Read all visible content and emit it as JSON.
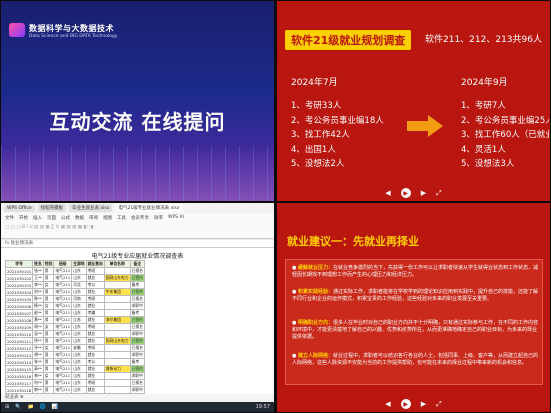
{
  "top_left": {
    "logo_title": "数据科学与大数据技术",
    "logo_subtitle": "Data Science and BIG DATA Technology",
    "main_text": "互动交流  在线提问"
  },
  "top_right": {
    "title": "软件21级就业规划调查",
    "subtitle": "软件211、212、213共96人",
    "left_heading": "2024年7月",
    "right_heading": "2024年9月",
    "left_items": [
      "1、考研33人",
      "2、考公务员事业编18人",
      "3、找工作42人",
      "4、出国1人",
      "5、没想法2人"
    ],
    "right_items": [
      "1、考研7人",
      "2、考公务员事业编25人",
      "3、找工作60人（已就业7人）",
      "4、灵活1人",
      "5、没想法3人"
    ],
    "accent": "#ffd000",
    "background": "#b8160f"
  },
  "bottom_right": {
    "title": "就业建议一：先就业再择业",
    "items": [
      {
        "lead": "缓解就业压力：",
        "text": "在就业竞争激烈的当下，先获得一份工作可以让求职者快速从学生就得业状态到工作状态，减轻因长期找不到理想工作而产生的心理压力和经济压力。"
      },
      {
        "lead": "积累实践经验：",
        "text": "通过实际工作，求职者能将在学校学到的理论知识应用到实践中，提升自己的技能，还能了解不同行业和企业的运作模式，积累宝贵的工作经验，这些经验对未来的职业发展至关重要。"
      },
      {
        "lead": "明确职业方向：",
        "text": "很多人在毕业时对自己的职业方向并不十分明确，只有通过实际参与工作，在不同的工作内容和环境中，才能更清楚地了解自己的兴趣、优势和劣势所在，从而更准确地确定自己的职业目标，为未来的择业提供依据。"
      },
      {
        "lead": "建立人际网络：",
        "text": "就业过程中，求职者可以结识各行各业的人士，包括同事、上级、客户等，从而建立起自己的人际网络，这些人脉资源不仅能为当前的工作提供帮助，也可能在未来的择业过程中带来新的机会和信息。"
      }
    ]
  },
  "bottom_left": {
    "tabs": [
      "WPS Office",
      "找稻壳模板",
      "毕业生就业表.xlsx",
      "电气21级专业就业情况表.xlsx"
    ],
    "ribbon_menu": [
      "文件",
      "开始",
      "插入",
      "页面",
      "公式",
      "数据",
      "审阅",
      "视图",
      "工具",
      "会员专享",
      "效率",
      "WPS AI"
    ],
    "formula_text": "fx  就业情况表",
    "sheet_title": "电气21级专业应届就业情况调查表",
    "headers": [
      "学号",
      "姓名",
      "性别",
      "班级",
      "生源地",
      "就业意向",
      "单位名称",
      "备注"
    ],
    "rows": [
      [
        "2021030101",
        "张**",
        "男",
        "电气211",
        "山东",
        "考研",
        "",
        "已报名"
      ],
      [
        "2021030102",
        "王**",
        "男",
        "电气211",
        "山东",
        "就业",
        "国网山东电力",
        "已签约"
      ],
      [
        "2021030103",
        "李**",
        "女",
        "电气211",
        "河北",
        "考公",
        "",
        "备考"
      ],
      [
        "2021030104",
        "刘**",
        "男",
        "电气211",
        "山东",
        "就业",
        "中车集团",
        "已签约"
      ],
      [
        "2021030105",
        "陈**",
        "男",
        "电气211",
        "河南",
        "考研",
        "",
        "已报名"
      ],
      [
        "2021030106",
        "杨**",
        "女",
        "电气211",
        "山东",
        "就业",
        "",
        "求职中"
      ],
      [
        "2021030107",
        "赵**",
        "男",
        "电气211",
        "山东",
        "考编",
        "",
        "备考"
      ],
      [
        "2021030108",
        "黄**",
        "男",
        "电气211",
        "江苏",
        "就业",
        "海尔集团",
        "已签约"
      ],
      [
        "2021030109",
        "周**",
        "女",
        "电气211",
        "山东",
        "考研",
        "",
        "已报名"
      ],
      [
        "2021030110",
        "吴**",
        "男",
        "电气211",
        "山东",
        "就业",
        "",
        "求职中"
      ],
      [
        "2021030111",
        "徐**",
        "男",
        "电气211",
        "山东",
        "就业",
        "国网山东电力",
        "已签约"
      ],
      [
        "2021030112",
        "孙**",
        "女",
        "电气211",
        "安徽",
        "考研",
        "",
        "已报名"
      ],
      [
        "2021030113",
        "胡**",
        "男",
        "电气211",
        "山东",
        "就业",
        "",
        "求职中"
      ],
      [
        "2021030114",
        "朱**",
        "男",
        "电气211",
        "山东",
        "考公",
        "",
        "备考"
      ],
      [
        "2021030115",
        "高**",
        "男",
        "电气211",
        "山东",
        "就业",
        "潍柴动力",
        "已签约"
      ],
      [
        "2021030116",
        "林**",
        "女",
        "电气211",
        "山东",
        "就业",
        "",
        "求职中"
      ],
      [
        "2021030117",
        "何**",
        "男",
        "电气211",
        "山东",
        "考研",
        "",
        "已报名"
      ],
      [
        "2021030118",
        "郭**",
        "男",
        "电气211",
        "山东",
        "就业",
        "",
        "求职中"
      ],
      [
        "2021030119",
        "马**",
        "男",
        "电气211",
        "山东",
        "就业",
        "国电南瑞",
        "已签约"
      ],
      [
        "2021030120",
        "罗**",
        "女",
        "电气211",
        "山东",
        "考编",
        "",
        "备考"
      ]
    ],
    "status_text": "就业表  ⊕",
    "taskbar_items": [
      "⊞",
      "🔍",
      "📁",
      "🌐",
      "📊"
    ],
    "clock": "19:57"
  },
  "navbar": {
    "prev": "◀",
    "next": "▶",
    "zoom": "⤢"
  }
}
